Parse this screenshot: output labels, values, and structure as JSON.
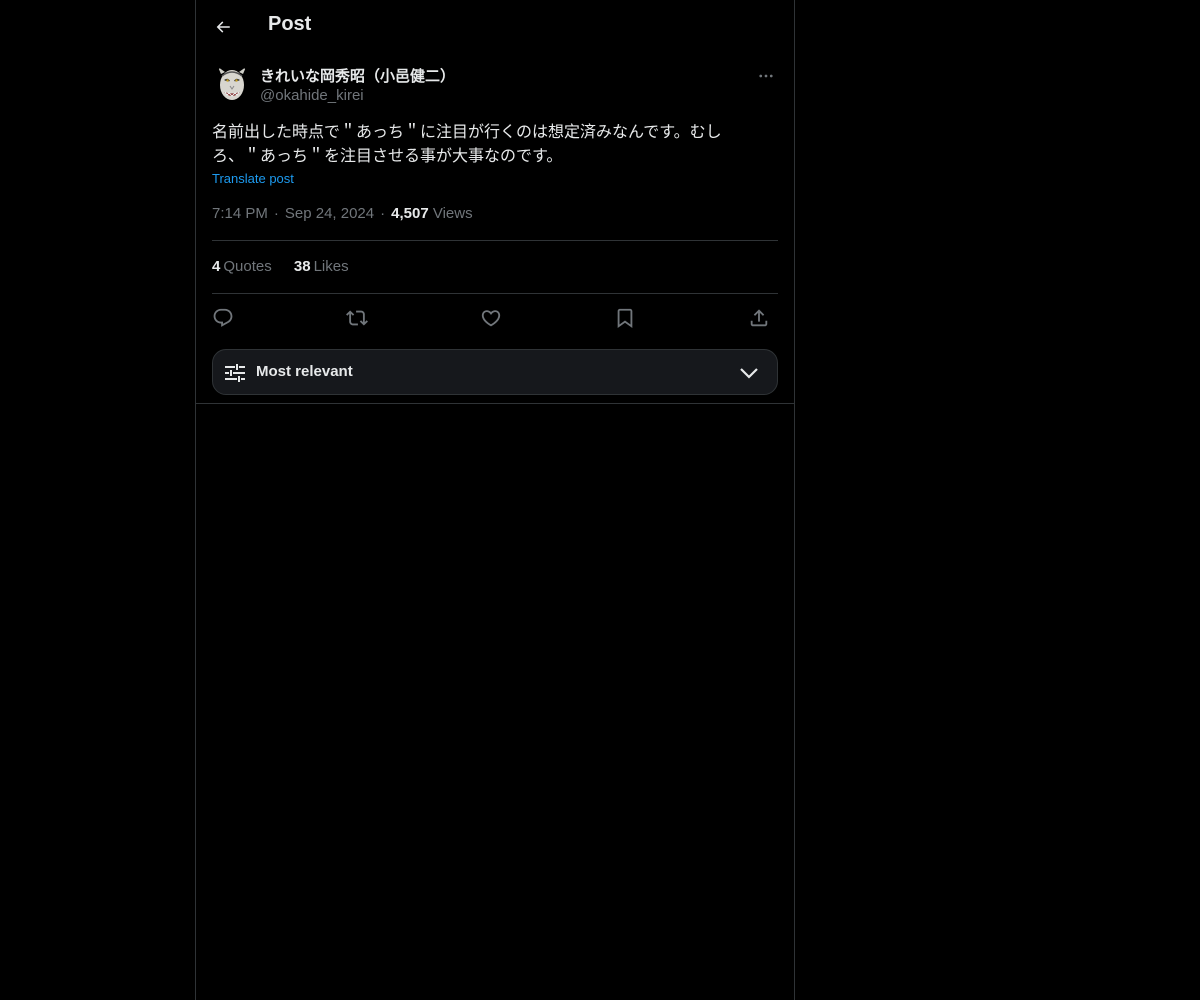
{
  "header": {
    "title": "Post",
    "back_icon": "arrow-left-icon"
  },
  "author": {
    "display_name": "きれいな岡秀昭（小邑健二）",
    "handle": "@okahide_kirei",
    "avatar": "hannya-mask-avatar",
    "more_icon": "more-dots-icon"
  },
  "post": {
    "text_line1": "名前出した時点で＂あっち＂に注目が行くのは想定済みなんです。むし",
    "text_line2": "ろ、＂あっち＂を注目させる事が大事なのです。",
    "translate_label": "Translate post",
    "time": "7:14 PM",
    "date": "Sep 24, 2024",
    "separator": "·",
    "views_count": "4,507",
    "views_label": "Views"
  },
  "stats": {
    "quotes_count": "4",
    "quotes_label": "Quotes",
    "likes_count": "38",
    "likes_label": "Likes"
  },
  "actions": [
    "reply-icon",
    "repost-icon",
    "like-icon",
    "bookmark-icon",
    "share-icon"
  ],
  "sort": {
    "label": "Most relevant",
    "icon": "sliders-icon",
    "chevron": "chevron-down-icon"
  },
  "colors": {
    "background": "#000000",
    "text": "#e7e9ea",
    "muted": "#71767b",
    "link": "#1d9bf0",
    "border": "#2f3336"
  }
}
